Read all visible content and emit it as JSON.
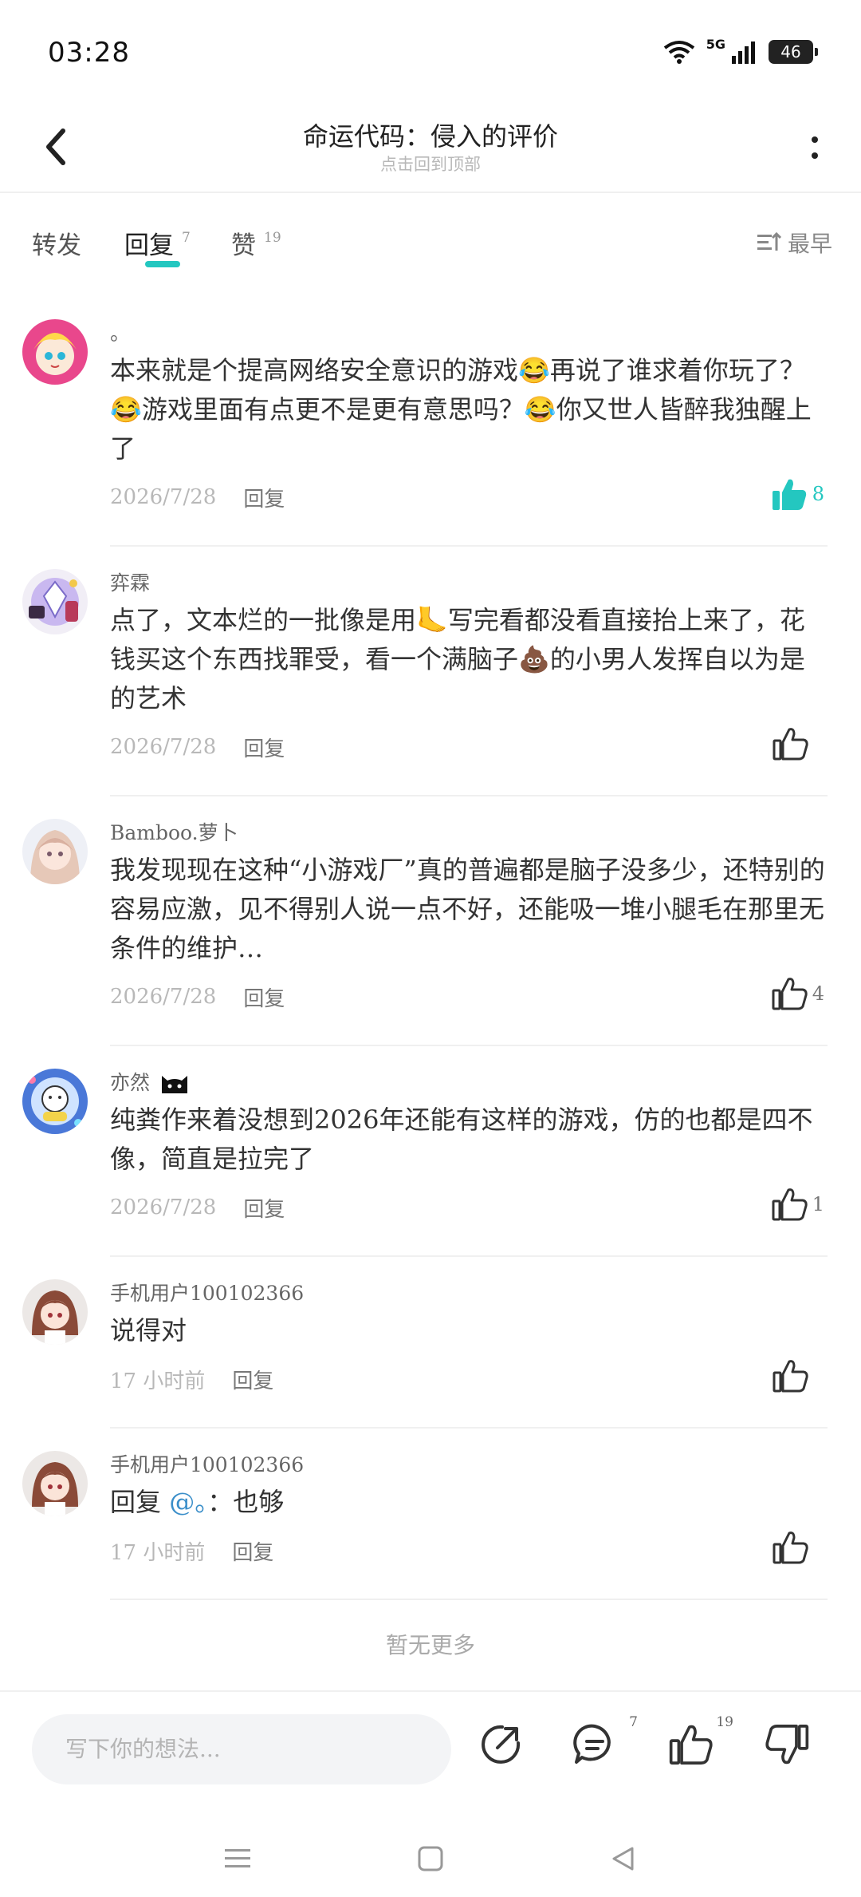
{
  "status_bar": {
    "time": "03:28",
    "network": "5G",
    "battery": "46"
  },
  "header": {
    "title": "命运代码：侵入的评价",
    "subtitle": "点击回到顶部"
  },
  "tabs": [
    {
      "label": "转发",
      "count": ""
    },
    {
      "label": "回复",
      "count": "7"
    },
    {
      "label": "赞",
      "count": "19"
    }
  ],
  "sort_label": "最早",
  "comments": [
    {
      "name": "。",
      "text": "本来就是个提高网络安全意识的游戏😂再说了谁求着你玩了？😂游戏里面有点更不是更有意思吗？😂你又世人皆醉我独醒上了",
      "date": "2026/7/28",
      "reply_label": "回复",
      "likes": "8",
      "liked": true
    },
    {
      "name": "弈霖",
      "text": "点了，文本烂的一批像是用🦶写完看都没看直接抬上来了，花钱买这个东西找罪受，看一个满脑子💩的小男人发挥自以为是的艺术",
      "date": "2026/7/28",
      "reply_label": "回复",
      "likes": "",
      "liked": false
    },
    {
      "name": "Bamboo.萝卜",
      "text": "我发现现在这种“小游戏厂”真的普遍都是脑子没多少，还特别的容易应激，见不得别人说一点不好，还能吸一堆小腿毛在那里无条件的维护…",
      "date": "2026/7/28",
      "reply_label": "回复",
      "likes": "4",
      "liked": false
    },
    {
      "name": "亦然",
      "text": "纯粪作来着没想到2026年还能有这样的游戏，仿的也都是四不像，简直是拉完了",
      "date": "2026/7/28",
      "reply_label": "回复",
      "likes": "1",
      "liked": false
    },
    {
      "name": "手机用户100102366",
      "text": "说得对",
      "date": "17 小时前",
      "reply_label": "回复",
      "likes": "",
      "liked": false
    },
    {
      "name": "手机用户100102366",
      "text_prefix": "回复 ",
      "mention": "@。",
      "text_suffix": "：也够",
      "date": "17 小时前",
      "reply_label": "回复",
      "likes": "",
      "liked": false
    }
  ],
  "no_more": "暂无更多",
  "bottom_bar": {
    "placeholder": "写下你的想法...",
    "comment_count": "7",
    "like_count": "19"
  },
  "colors": {
    "accent": "#24c7c0",
    "mention": "#3a8ec9"
  },
  "icons": [
    "back-icon",
    "more-icon",
    "sort-icon",
    "thumbs-up-icon",
    "share-icon",
    "comment-icon",
    "thumbs-down-icon",
    "menu-icon",
    "home-icon",
    "back-triangle-icon"
  ]
}
